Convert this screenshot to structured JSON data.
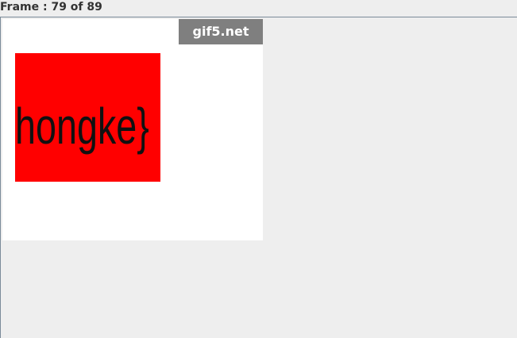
{
  "header": {
    "frame_label": "Frame : 79 of 89"
  },
  "frame": {
    "watermark": "gif5.net",
    "text": "hongke}"
  },
  "colors": {
    "background": "#eeeeee",
    "canvas": "#ffffff",
    "watermark_bg": "#7f7f7f",
    "box": "#ff0000",
    "text": "#111111"
  }
}
